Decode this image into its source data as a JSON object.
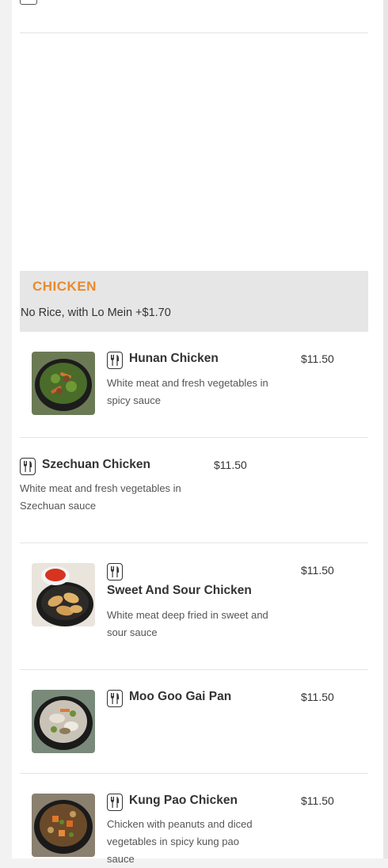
{
  "category": {
    "title": "CHICKEN",
    "note": "No Rice, with Lo Mein +$1.70"
  },
  "items": [
    {
      "name": "Hunan Chicken",
      "description": "White meat and fresh vegetables in spicy sauce",
      "price": "$11.50",
      "icon": "fork-knife-icon"
    },
    {
      "name": "Szechuan Chicken",
      "description": "White meat and fresh vegetables in Szechuan sauce",
      "price": "$11.50",
      "icon": "fork-knife-icon"
    },
    {
      "name": "Sweet And Sour Chicken",
      "description": "White meat deep fried in sweet and sour sauce",
      "price": "$11.50",
      "icon": "fork-knife-icon"
    },
    {
      "name": "Moo Goo Gai Pan",
      "description": "",
      "price": "$11.50",
      "icon": "fork-knife-icon"
    },
    {
      "name": "Kung Pao Chicken",
      "description": "Chicken with peanuts and diced vegetables in spicy kung pao sauce",
      "price": "$11.50",
      "icon": "fork-knife-icon"
    }
  ],
  "colors": {
    "accent": "#ea8a2c",
    "header_bg": "#e6e6e6",
    "text": "#333333"
  }
}
